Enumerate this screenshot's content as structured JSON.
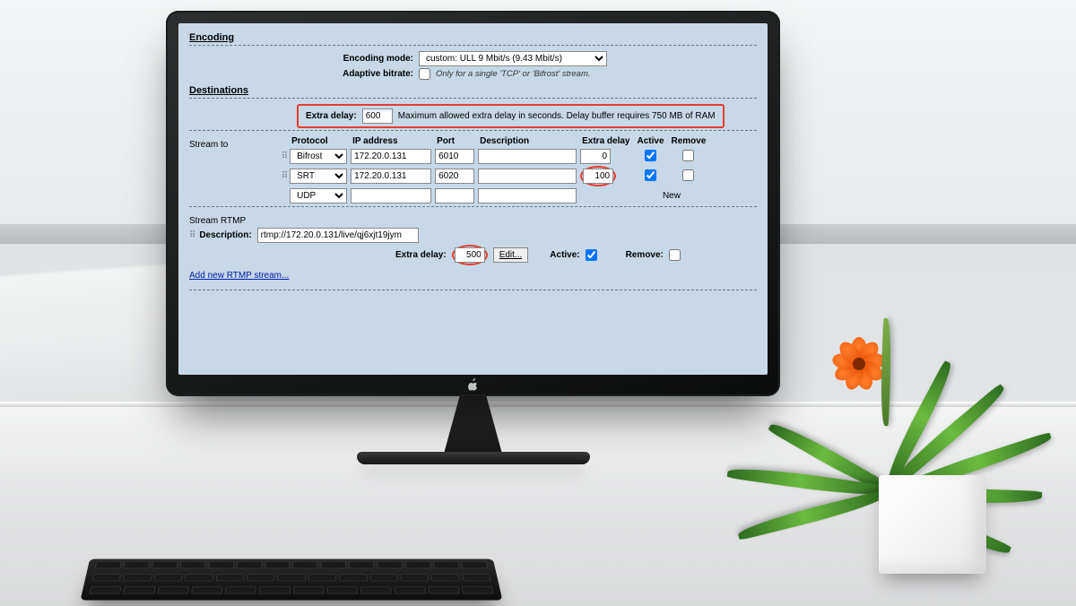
{
  "encoding": {
    "section_title": "Encoding",
    "mode_label": "Encoding mode:",
    "mode_value": "custom: ULL 9 Mbit/s (9.43 Mbit/s)",
    "adaptive_label": "Adaptive bitrate:",
    "adaptive_checked": false,
    "adaptive_hint": "Only for a single 'TCP' or 'Bifrost' stream."
  },
  "destinations": {
    "section_title": "Destinations",
    "extra_delay_label": "Extra delay:",
    "extra_delay_value": "600",
    "extra_delay_hint": "Maximum allowed extra delay in seconds. Delay buffer requires 750 MB of RAM",
    "stream_to_label": "Stream to",
    "columns": {
      "protocol": "Protocol",
      "ip": "IP address",
      "port": "Port",
      "description": "Description",
      "extra_delay": "Extra delay",
      "active": "Active",
      "remove": "Remove"
    },
    "rows": [
      {
        "protocol": "Bifrost",
        "ip": "172.20.0.131",
        "port": "6010",
        "description": "",
        "extra_delay": "0",
        "active": true,
        "remove": false
      },
      {
        "protocol": "SRT",
        "ip": "172.20.0.131",
        "port": "6020",
        "description": "",
        "extra_delay": "100",
        "active": true,
        "remove": false
      },
      {
        "protocol": "UDP",
        "ip": "",
        "port": "",
        "description": "",
        "extra_delay": "",
        "active": false,
        "remove": false
      }
    ],
    "new_label": "New"
  },
  "rtmp": {
    "section_label": "Stream RTMP",
    "description_label": "Description:",
    "description_value": "rtmp://172.20.0.131/live/qj6xjt19jym",
    "extra_delay_label": "Extra delay:",
    "extra_delay_value": "500",
    "edit_label": "Edit...",
    "active_label": "Active:",
    "active_checked": true,
    "remove_label": "Remove:",
    "remove_checked": false,
    "add_link": "Add new RTMP stream..."
  }
}
